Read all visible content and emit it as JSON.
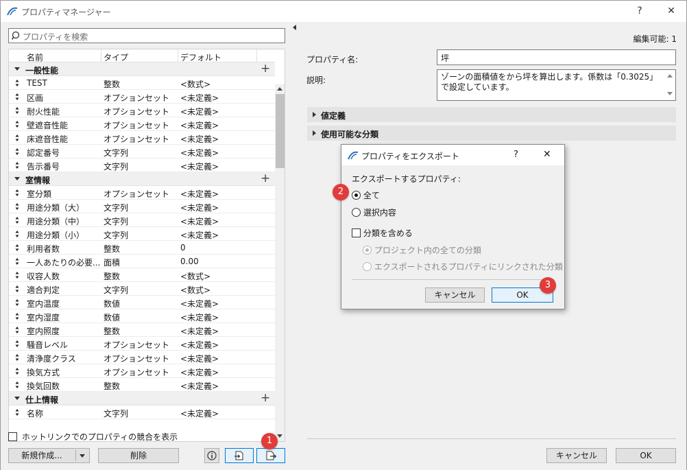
{
  "window": {
    "title": "プロパティマネージャー",
    "help": "?",
    "close": "✕"
  },
  "search": {
    "placeholder": "プロパティを検索"
  },
  "columns": {
    "name": "名前",
    "type": "タイプ",
    "default": "デフォルト"
  },
  "groups": [
    {
      "label": "一般性能",
      "rows": [
        {
          "name": "TEST",
          "type": "整数",
          "default": "<数式>"
        },
        {
          "name": "区画",
          "type": "オプションセット",
          "default": "<未定義>"
        },
        {
          "name": "耐火性能",
          "type": "オプションセット",
          "default": "<未定義>"
        },
        {
          "name": "壁遮音性能",
          "type": "オプションセット",
          "default": "<未定義>"
        },
        {
          "name": "床遮音性能",
          "type": "オプションセット",
          "default": "<未定義>"
        },
        {
          "name": "認定番号",
          "type": "文字列",
          "default": "<未定義>"
        },
        {
          "name": "告示番号",
          "type": "文字列",
          "default": "<未定義>"
        }
      ]
    },
    {
      "label": "室情報",
      "rows": [
        {
          "name": "室分類",
          "type": "オプションセット",
          "default": "<未定義>"
        },
        {
          "name": "用途分類（大）",
          "type": "文字列",
          "default": "<未定義>"
        },
        {
          "name": "用途分類（中）",
          "type": "文字列",
          "default": "<未定義>"
        },
        {
          "name": "用途分類（小）",
          "type": "文字列",
          "default": "<未定義>"
        },
        {
          "name": "利用者数",
          "type": "整数",
          "default": "0"
        },
        {
          "name": "一人あたりの必要...",
          "type": "面積",
          "default": "0.00"
        },
        {
          "name": "収容人数",
          "type": "整数",
          "default": "<数式>"
        },
        {
          "name": "適合判定",
          "type": "文字列",
          "default": "<数式>"
        },
        {
          "name": "室内温度",
          "type": "数値",
          "default": "<未定義>"
        },
        {
          "name": "室内湿度",
          "type": "数値",
          "default": "<未定義>"
        },
        {
          "name": "室内照度",
          "type": "整数",
          "default": "<未定義>"
        },
        {
          "name": "騒音レベル",
          "type": "オプションセット",
          "default": "<未定義>"
        },
        {
          "name": "清浄度クラス",
          "type": "オプションセット",
          "default": "<未定義>"
        },
        {
          "name": "換気方式",
          "type": "オプションセット",
          "default": "<未定義>"
        },
        {
          "name": "換気回数",
          "type": "整数",
          "default": "<未定義>"
        }
      ]
    },
    {
      "label": "仕上情報",
      "rows": [
        {
          "name": "名称",
          "type": "文字列",
          "default": "<未定義>"
        }
      ]
    }
  ],
  "left_footer": {
    "conflict_label": "ホットリンクでのプロパティの競合を表示",
    "new_label": "新規作成...",
    "delete_label": "削除",
    "info_icon": "info-icon",
    "import_icon": "import-icon",
    "export_icon": "export-icon"
  },
  "right": {
    "editable_label": "編集可能: 1",
    "property_name_label": "プロパティ名:",
    "property_name_value": "坪",
    "description_label": "説明:",
    "description_value": "ゾーンの面積値をから坪を算出します。係数は「0.3025」で設定しています。",
    "section_value": "値定義",
    "section_classifications": "使用可能な分類",
    "cancel_label": "キャンセル",
    "ok_label": "OK"
  },
  "export_dialog": {
    "title": "プロパティをエクスポート",
    "help": "?",
    "close": "✕",
    "group_label": "エクスポートするプロパティ:",
    "opt_all": "全て",
    "opt_selection": "選択内容",
    "include_class_label": "分類を含める",
    "sub_all": "プロジェクト内の全ての分類",
    "sub_linked": "エクスポートされるプロパティにリンクされた分類",
    "cancel_label": "キャンセル",
    "ok_label": "OK"
  },
  "badges": {
    "b1": "1",
    "b2": "2",
    "b3": "3"
  },
  "colors": {
    "badge": "#e23b3b",
    "accent": "#0078d7"
  }
}
